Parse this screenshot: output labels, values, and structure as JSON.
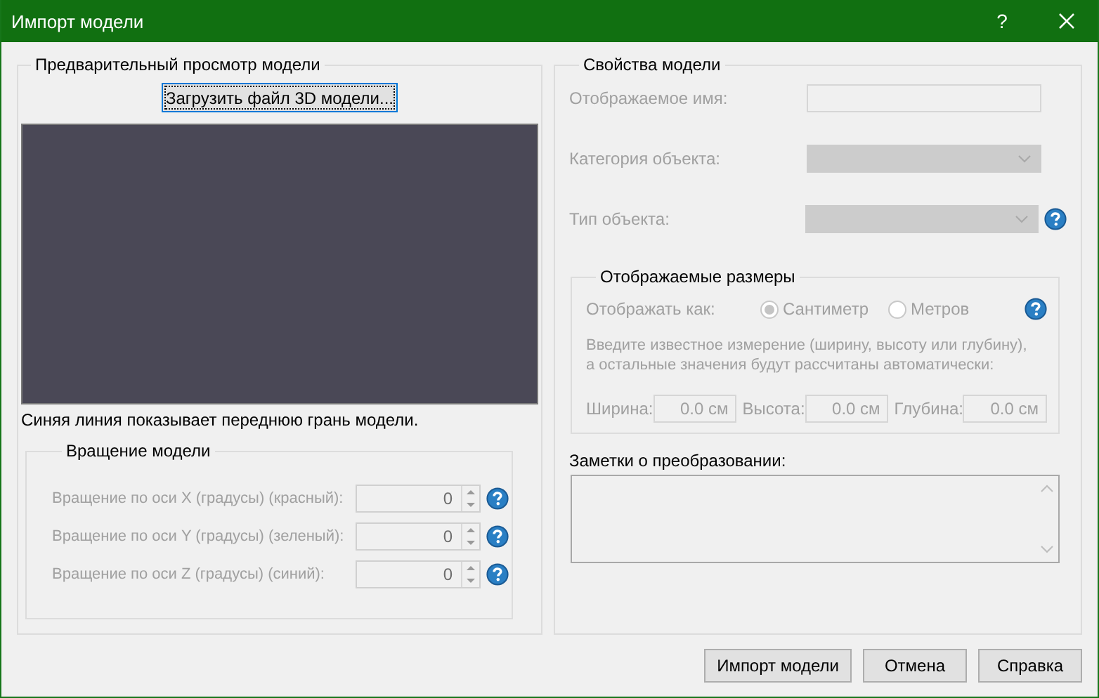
{
  "window": {
    "title": "Импорт модели",
    "help_button": "?"
  },
  "preview": {
    "title": "Предварительный просмотр модели",
    "load_button": {
      "label": "Загрузить файл 3D модели...",
      "focused": true
    },
    "hint": "Синяя линия показывает переднюю грань модели."
  },
  "rotation": {
    "title": "Вращение модели",
    "rows": [
      {
        "label": "Вращение по оси X (градусы) (красный):",
        "value": "0",
        "disabled": true
      },
      {
        "label": "Вращение по оси Y (градусы) (зеленый):",
        "value": "0",
        "disabled": true
      },
      {
        "label": "Вращение по оси Z (градусы) (синий):",
        "value": "0",
        "disabled": true
      }
    ]
  },
  "properties": {
    "title": "Свойства модели",
    "fields": [
      {
        "kind": "text",
        "label": "Отображаемое имя:",
        "disabled": true,
        "help": false
      },
      {
        "kind": "combo",
        "label": "Категория объекта:",
        "disabled": true,
        "help": false
      },
      {
        "kind": "combo",
        "label": "Тип объекта:",
        "disabled": true,
        "help": true
      }
    ]
  },
  "dimensions": {
    "title": "Отображаемые размеры",
    "disabled": true,
    "display_as_label": "Отображать как:",
    "units": [
      {
        "label": "Сантиметр",
        "selected": true
      },
      {
        "label": "Метров",
        "selected": false
      }
    ],
    "instruction": "Введите известное измерение (ширину, высоту или глубину),\nа остальные значения будут рассчитаны автоматически:",
    "sizes": [
      {
        "label": "Ширина:",
        "value": "0.0 см"
      },
      {
        "label": "Высота:",
        "value": "0.0 см"
      },
      {
        "label": "Глубина:",
        "value": "0.0 см"
      }
    ]
  },
  "notes": {
    "label": "Заметки о преобразовании:"
  },
  "buttons": [
    {
      "label": "Импорт модели"
    },
    {
      "label": "Отмена"
    },
    {
      "label": "Справка"
    }
  ]
}
